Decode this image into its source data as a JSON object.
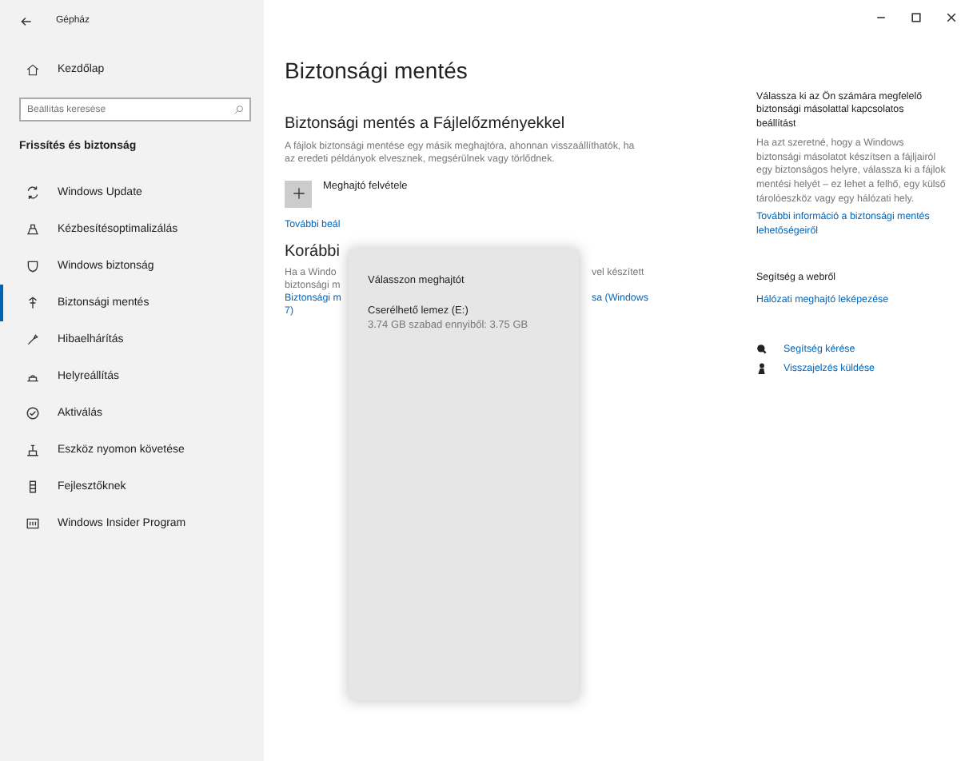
{
  "window": {
    "title": "Gépház"
  },
  "sidebar": {
    "home": "Kezdőlap",
    "search": {
      "placeholder": "Beállítás keresése"
    },
    "section": "Frissítés és biztonság",
    "items": [
      {
        "label": "Windows Update",
        "selected": false
      },
      {
        "label": "Kézbesítésoptimalizálás",
        "selected": false
      },
      {
        "label": "Windows biztonság",
        "selected": false
      },
      {
        "label": "Biztonsági mentés",
        "selected": true
      },
      {
        "label": "Hibaelhárítás",
        "selected": false
      },
      {
        "label": "Helyreállítás",
        "selected": false
      },
      {
        "label": "Aktiválás",
        "selected": false
      },
      {
        "label": "Eszköz nyomon követése",
        "selected": false
      },
      {
        "label": "Fejlesztőknek",
        "selected": false
      },
      {
        "label": "Windows Insider Program",
        "selected": false
      }
    ]
  },
  "main": {
    "title": "Biztonsági mentés",
    "file_history": {
      "heading": "Biztonsági mentés a Fájlelőzményekkel",
      "description": "A fájlok biztonsági mentése egy másik meghajtóra, ahonnan visszaállíthatók, ha az eredeti példányok elvesznek, megsérülnek vagy törlődnek.",
      "add_drive": "Meghajtó felvétele",
      "more_link": "További beál"
    },
    "older": {
      "heading": "Korábbi",
      "left_lines": [
        "Ha a Windo",
        "biztonsági m"
      ],
      "right_line": "vel készített",
      "link_left": "Biztonsági m",
      "link_right": "sa (Windows",
      "link_end": "7)"
    }
  },
  "popup": {
    "title": "Válasszon meghajtót",
    "drives": [
      {
        "name": "Cserélhető lemez (E:)",
        "space": "3.74 GB szabad ennyiből: 3.75 GB"
      }
    ]
  },
  "aside": {
    "heading": "Válassza ki az Ön számára megfelelő biztonsági másolattal kapcsolatos beállítást",
    "text": "Ha azt szeretné, hogy a Windows biztonsági másolatot készítsen a fájljairól egy biztonságos helyre, válassza ki a fájlok mentési helyét – ez lehet a felhő, egy külső tárolóeszköz vagy egy hálózati hely.",
    "link": "További információ a biztonsági mentés lehetőségeiről",
    "web_heading": "Segítség a webről",
    "web_link": "Hálózati meghajtó leképezése",
    "actions": [
      "Segítség kérése",
      "Visszajelzés küldése"
    ]
  }
}
